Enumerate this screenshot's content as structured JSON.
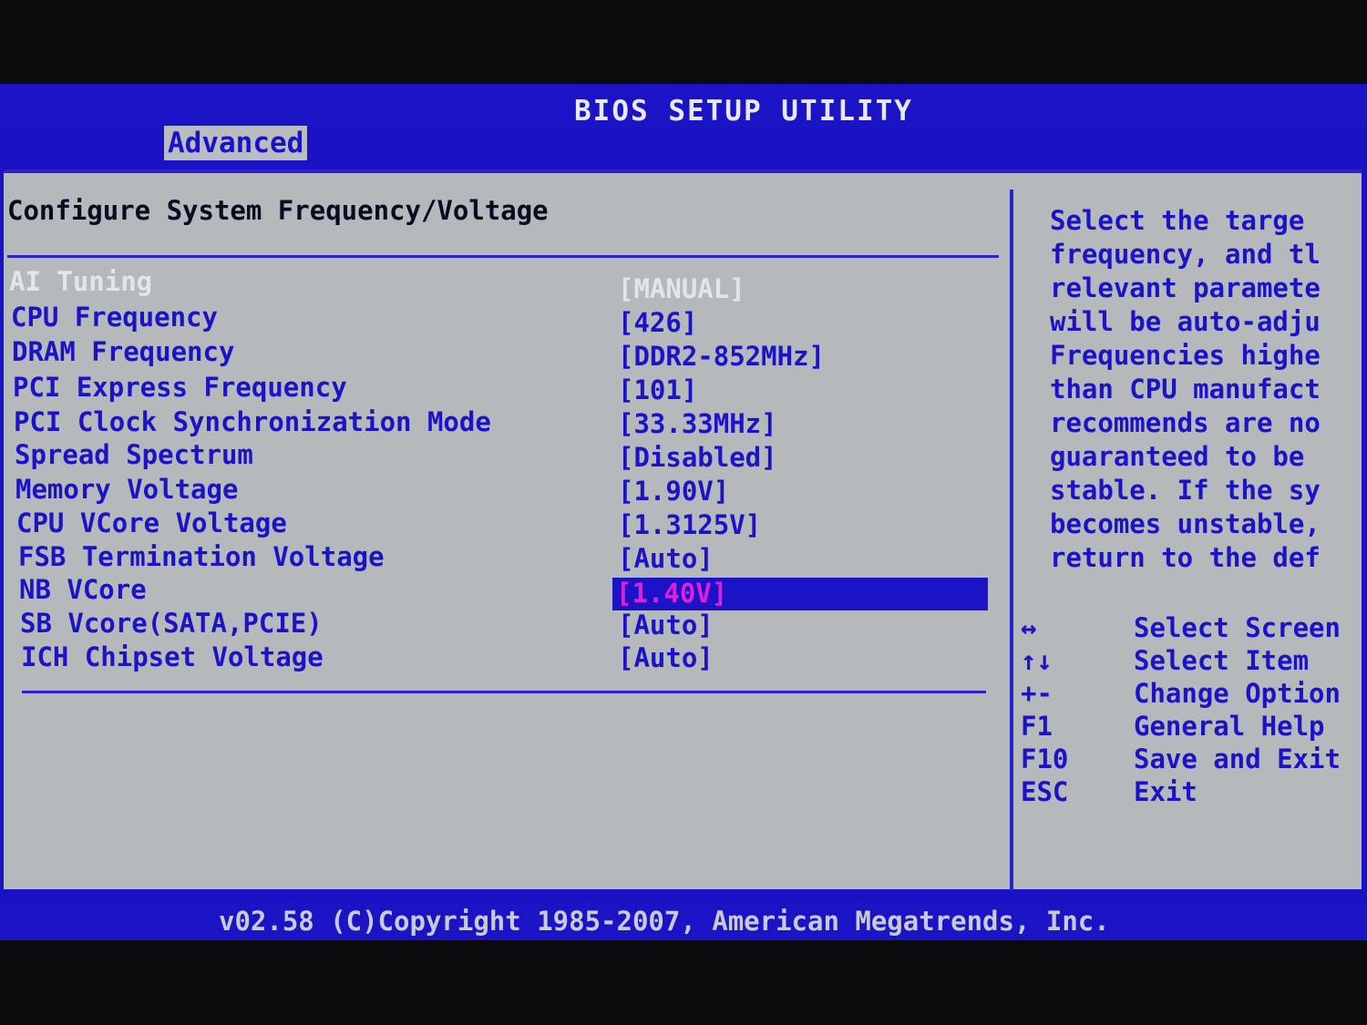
{
  "header": {
    "title": "BIOS SETUP UTILITY",
    "active_tab": "Advanced"
  },
  "section": {
    "title": "Configure System Frequency/Voltage"
  },
  "settings": [
    {
      "label": "AI Tuning",
      "value": "[MANUAL]"
    },
    {
      "label": "CPU Frequency",
      "value": "[426]"
    },
    {
      "label": "DRAM Frequency",
      "value": "[DDR2-852MHz]"
    },
    {
      "label": "PCI Express Frequency",
      "value": "[101]"
    },
    {
      "label": "PCI Clock Synchronization Mode",
      "value": "[33.33MHz]"
    },
    {
      "label": "Spread Spectrum",
      "value": "[Disabled]"
    },
    {
      "label": "Memory Voltage",
      "value": "[1.90V]"
    },
    {
      "label": "CPU VCore Voltage",
      "value": "[1.3125V]"
    },
    {
      "label": "FSB Termination Voltage",
      "value": "[Auto]"
    },
    {
      "label": "NB VCore",
      "value": "[1.40V]"
    },
    {
      "label": "SB Vcore(SATA,PCIE)",
      "value": "[Auto]"
    },
    {
      "label": "ICH Chipset Voltage",
      "value": "[Auto]"
    }
  ],
  "help_text": [
    "Select the targe",
    "frequency, and tl",
    "relevant paramete",
    "will be auto-adju",
    "Frequencies highe",
    "than CPU manufact",
    "recommends are no",
    "guaranteed to be",
    "stable. If the sy",
    "becomes unstable,",
    "return to the def"
  ],
  "key_legend": [
    {
      "key": "↔",
      "action": "Select Screen"
    },
    {
      "key": "↑↓",
      "action": "Select Item"
    },
    {
      "key": "+-",
      "action": "Change Option"
    },
    {
      "key": "F1",
      "action": "General Help"
    },
    {
      "key": "F10",
      "action": "Save and Exit"
    },
    {
      "key": "ESC",
      "action": "Exit"
    }
  ],
  "footer": {
    "text": "v02.58 (C)Copyright 1985-2007, American Megatrends, Inc."
  },
  "colors": {
    "background": "#b5b9bc",
    "accent": "#1c13c8",
    "selected_value": "#e020d8"
  }
}
